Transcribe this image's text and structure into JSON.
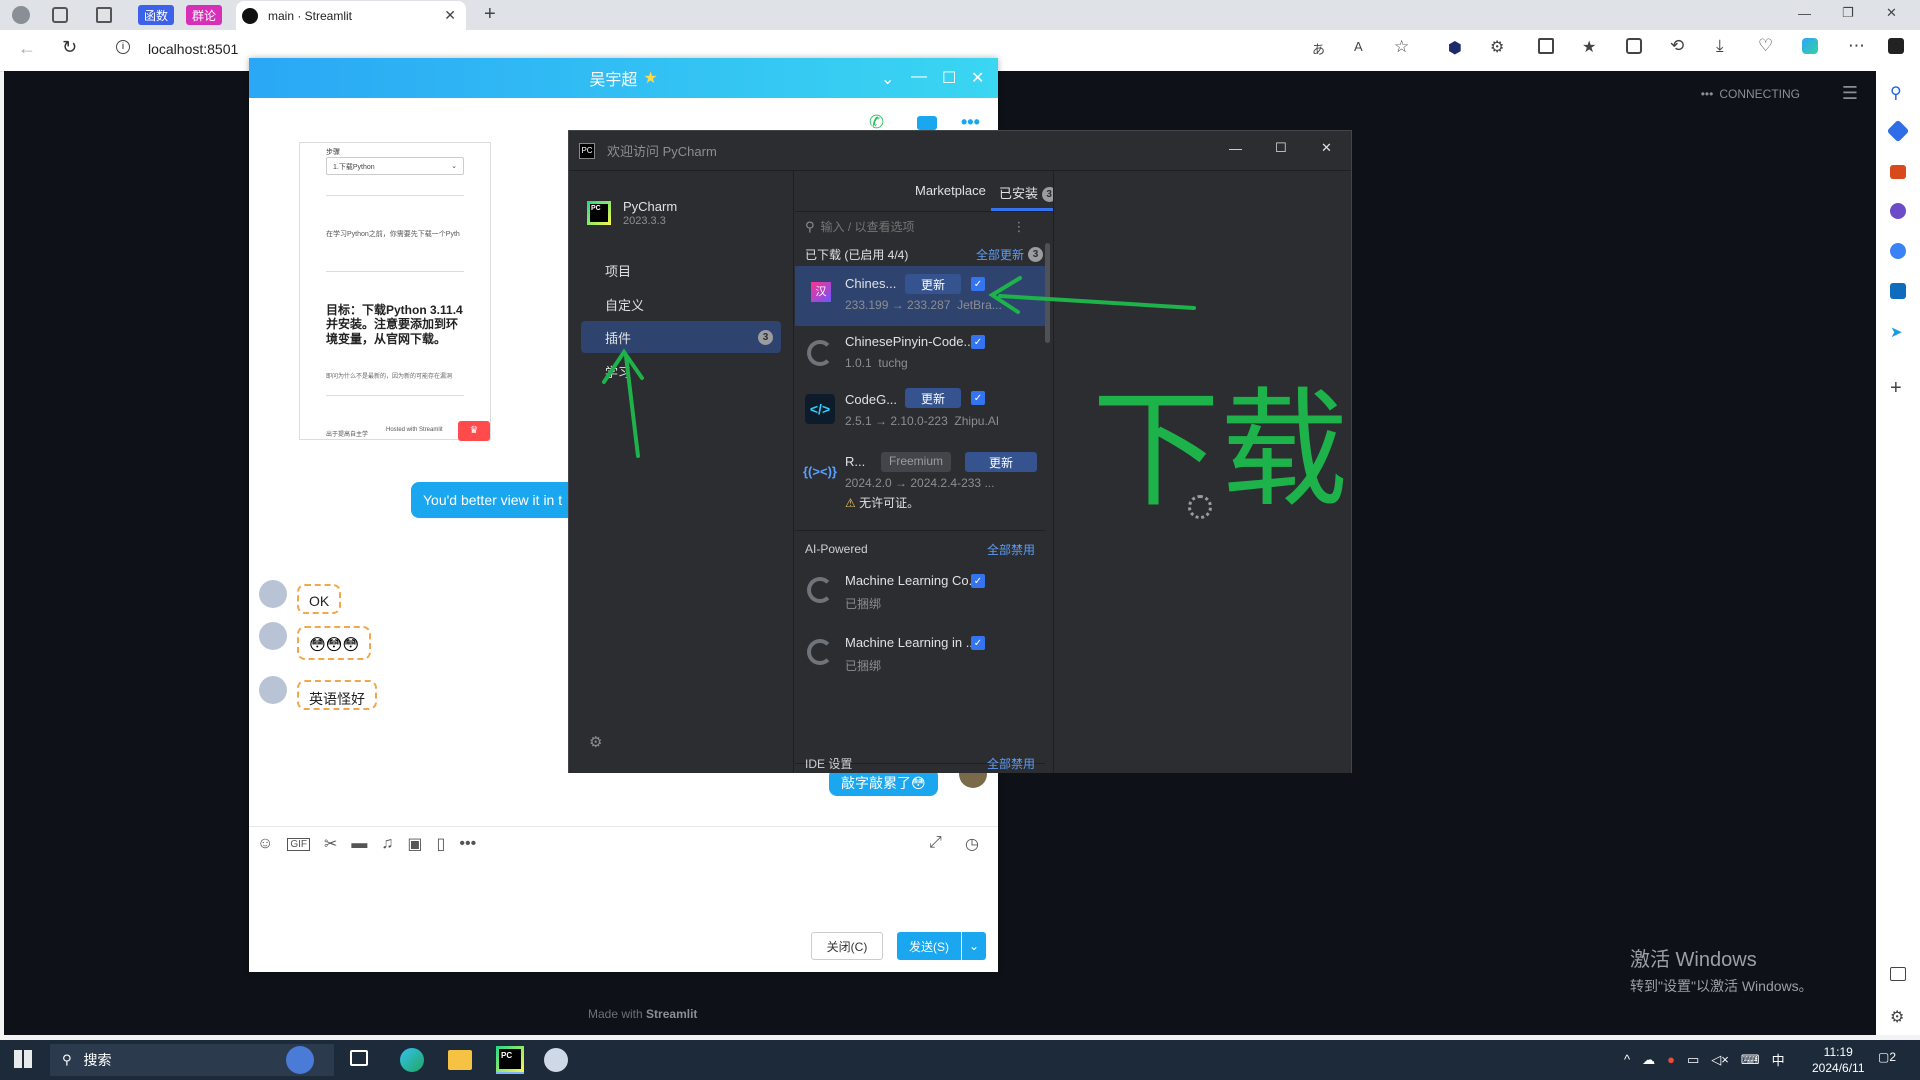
{
  "browser": {
    "ext_tabs": [
      "函数",
      "群论"
    ],
    "tab_title": "main · Streamlit",
    "url": "localhost:8501"
  },
  "streamlit": {
    "status": "CONNECTING",
    "footer_prefix": "Made with",
    "footer_brand": "Streamlit"
  },
  "watermark": {
    "line1": "激活 Windows",
    "line2": "转到\"设置\"以激活 Windows。"
  },
  "qq": {
    "title": "吴宇超",
    "preview": {
      "step_label": "步骤",
      "select": "1.下载Python",
      "para": "在学习Python之前，你需要先下载一个Pyth",
      "goal": "目标：下载Python 3.11.4并安装。注意要添加到环境变量，从官网下载。",
      "small": "即问为什么不是最新的，因为新的可能存在漏洞",
      "foot1": "出于提高自主学",
      "foot2": "Hosted with Streamlit"
    },
    "msg_blue": "You'd better view it in t",
    "msgs": [
      "OK",
      "😳😳😳",
      "英语怪好"
    ],
    "msg_right": "敲字敲累了😳",
    "close_btn": "关闭(C)",
    "send_btn": "发送(S)"
  },
  "pycharm": {
    "window_title": "欢迎访问 PyCharm",
    "product": "PyCharm",
    "version": "2023.3.3",
    "nav": [
      {
        "label": "项目"
      },
      {
        "label": "自定义"
      },
      {
        "label": "插件",
        "badge": "3"
      },
      {
        "label": "学习"
      }
    ],
    "tabs": {
      "marketplace": "Marketplace",
      "installed": "已安装",
      "installed_badge": "3"
    },
    "search_placeholder": "输入 / 以查看选项",
    "downloaded_header": "已下载 (已启用 4/4)",
    "update_all": "全部更新",
    "update_all_badge": "3",
    "plugins": [
      {
        "name": "Chines...",
        "version": "233.199 → 233.287",
        "vendor": "JetBra...",
        "action": "更新"
      },
      {
        "name": "ChinesePinyin-Code...",
        "version": "1.0.1",
        "vendor": "tuchg"
      },
      {
        "name": "CodeG...",
        "version": "2.5.1 → 2.10.0-223",
        "vendor": "Zhipu.AI",
        "action": "更新"
      },
      {
        "name": "R...",
        "tag": "Freemium",
        "version": "2024.2.0 → 2024.2.4-233",
        "vendor": "...",
        "action": "更新",
        "warning": "无许可证。"
      }
    ],
    "ai_header": "AI-Powered",
    "disable_all": "全部禁用",
    "ai_plugins": [
      {
        "name": "Machine Learning Co...",
        "sub": "已捆绑"
      },
      {
        "name": "Machine Learning in ...",
        "sub": "已捆绑"
      }
    ],
    "ide_header": "IDE 设置",
    "ide_disable_all": "全部禁用"
  },
  "annotation": {
    "text": "下载",
    "color": "#1db34a"
  },
  "taskbar": {
    "search": "搜索",
    "time": "11:19",
    "date": "2024/6/11",
    "ime": "中",
    "notif": "2"
  }
}
